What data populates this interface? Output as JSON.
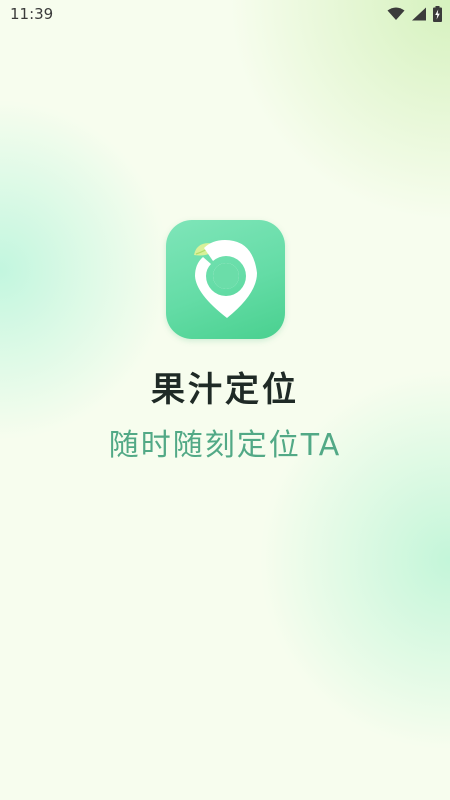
{
  "status_bar": {
    "time": "11:39",
    "icons": [
      "wifi-icon",
      "cellular-signal-icon",
      "battery-charging-icon"
    ]
  },
  "splash": {
    "app_icon": "juice-location-pin-logo",
    "app_name": "果汁定位",
    "slogan": "随时随刻定位TA"
  },
  "colors": {
    "background": "#f7fdee",
    "icon_green": "#64dca6",
    "slogan_green": "#52a986",
    "app_name_text": "#1f2a26"
  }
}
